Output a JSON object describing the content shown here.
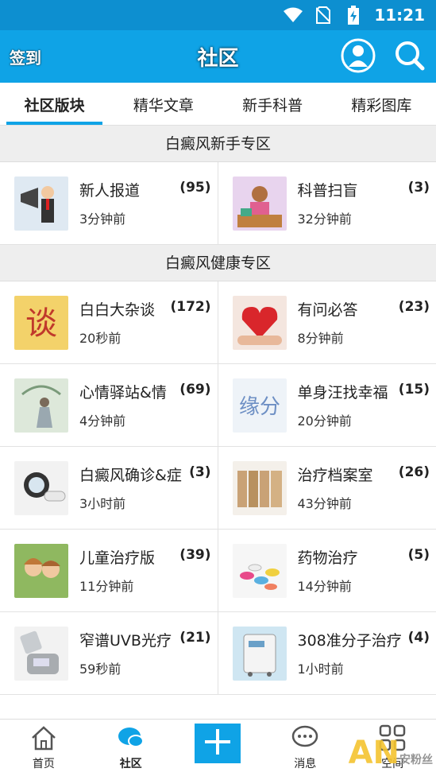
{
  "status": {
    "time": "11:21"
  },
  "header": {
    "signin": "签到",
    "title": "社区"
  },
  "tabs": [
    {
      "label": "社区版块",
      "active": true
    },
    {
      "label": "精华文章",
      "active": false
    },
    {
      "label": "新手科普",
      "active": false
    },
    {
      "label": "精彩图库",
      "active": false
    }
  ],
  "sections": [
    {
      "title": "白癜风新手专区",
      "items": [
        {
          "name": "新人报道",
          "count": "(95)",
          "time": "3分钟前"
        },
        {
          "name": "科普扫盲",
          "count": "(3)",
          "time": "32分钟前"
        }
      ]
    },
    {
      "title": "白癜风健康专区",
      "items": [
        {
          "name": "白白大杂谈",
          "count": "(172)",
          "time": "20秒前"
        },
        {
          "name": "有问必答",
          "count": "(23)",
          "time": "8分钟前"
        },
        {
          "name": "心情驿站&情",
          "count": "(69)",
          "time": "4分钟前"
        },
        {
          "name": "单身汪找幸福",
          "count": "(15)",
          "time": "20分钟前"
        },
        {
          "name": "白癜风确诊&症",
          "count": "(3)",
          "time": "3小时前"
        },
        {
          "name": "治疗档案室",
          "count": "(26)",
          "time": "43分钟前"
        },
        {
          "name": "儿童治疗版",
          "count": "(39)",
          "time": "11分钟前"
        },
        {
          "name": "药物治疗",
          "count": "(5)",
          "time": "14分钟前"
        },
        {
          "name": "窄谱UVB光疗",
          "count": "(21)",
          "time": "59秒前"
        },
        {
          "name": "308准分子治疗",
          "count": "(4)",
          "time": "1小时前"
        }
      ]
    }
  ],
  "bottom_nav": [
    {
      "label": "首页",
      "icon": "home-icon"
    },
    {
      "label": "社区",
      "icon": "chat-bubble-icon",
      "active": true
    },
    {
      "label": "",
      "icon": "plus-icon"
    },
    {
      "label": "消息",
      "icon": "message-icon"
    },
    {
      "label": "空间",
      "icon": "grid-icon"
    }
  ],
  "watermark": {
    "text": "AN",
    "sub": "安粉丝"
  },
  "colors": {
    "accent": "#0fa3e6",
    "statusbar": "#0d8fd0"
  }
}
